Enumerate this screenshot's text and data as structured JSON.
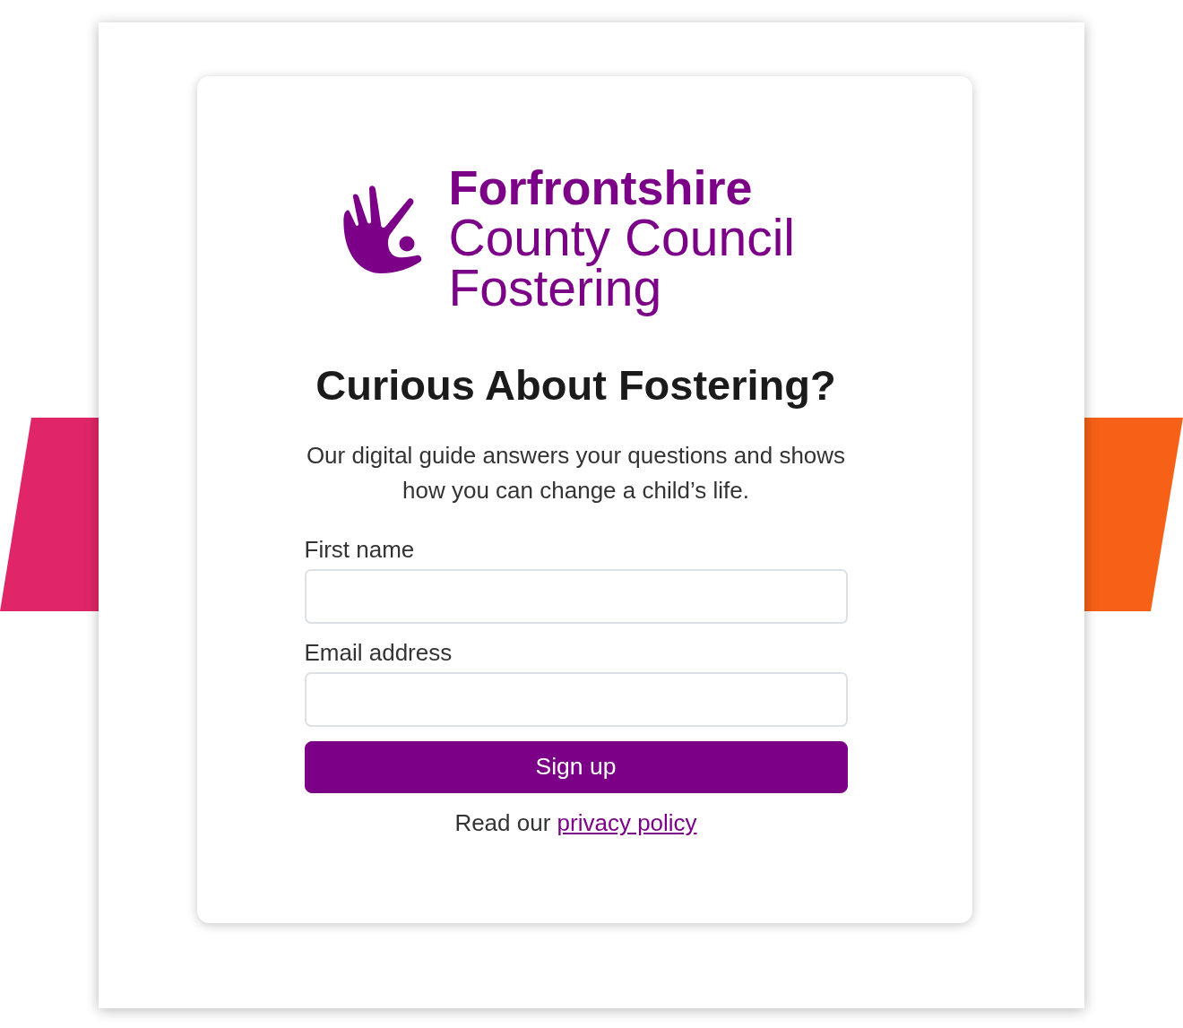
{
  "logo": {
    "name": "Forfrontshire",
    "lines": [
      "County Council",
      "Fostering"
    ]
  },
  "heading": "Curious About Fostering?",
  "intro": "Our digital guide answers your questions and shows how you can change a child’s life.",
  "form": {
    "fields": [
      {
        "label": "First name"
      },
      {
        "label": "Email address"
      }
    ],
    "submit": "Sign up"
  },
  "privacy_note": {
    "text": "Read our",
    "link": "privacy policy"
  }
}
